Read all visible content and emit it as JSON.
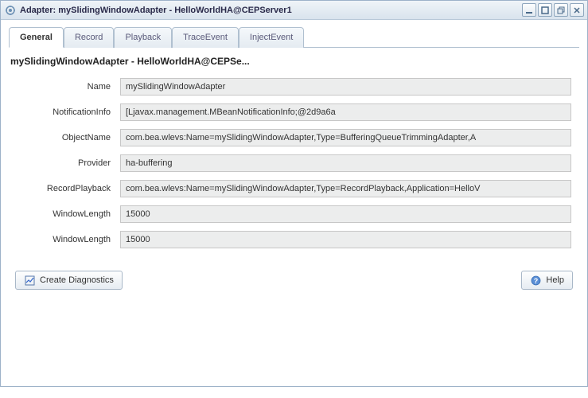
{
  "window": {
    "title": "Adapter: mySlidingWindowAdapter - HelloWorldHA@CEPServer1"
  },
  "tabs": {
    "general": "General",
    "record": "Record",
    "playback": "Playback",
    "traceevent": "TraceEvent",
    "injectevent": "InjectEvent"
  },
  "panel": {
    "heading": "mySlidingWindowAdapter - HelloWorldHA@CEPSe..."
  },
  "fields": {
    "name": {
      "label": "Name",
      "value": "mySlidingWindowAdapter"
    },
    "notificationInfo": {
      "label": "NotificationInfo",
      "value": "[Ljavax.management.MBeanNotificationInfo;@2d9a6a"
    },
    "objectName": {
      "label": "ObjectName",
      "value": "com.bea.wlevs:Name=mySlidingWindowAdapter,Type=BufferingQueueTrimmingAdapter,A"
    },
    "provider": {
      "label": "Provider",
      "value": "ha-buffering"
    },
    "recordPlayback": {
      "label": "RecordPlayback",
      "value": "com.bea.wlevs:Name=mySlidingWindowAdapter,Type=RecordPlayback,Application=HelloV"
    },
    "windowLength1": {
      "label": "WindowLength",
      "value": "15000"
    },
    "windowLength2": {
      "label": "WindowLength",
      "value": "15000"
    }
  },
  "buttons": {
    "createDiagnostics": "Create Diagnostics",
    "help": "Help"
  }
}
